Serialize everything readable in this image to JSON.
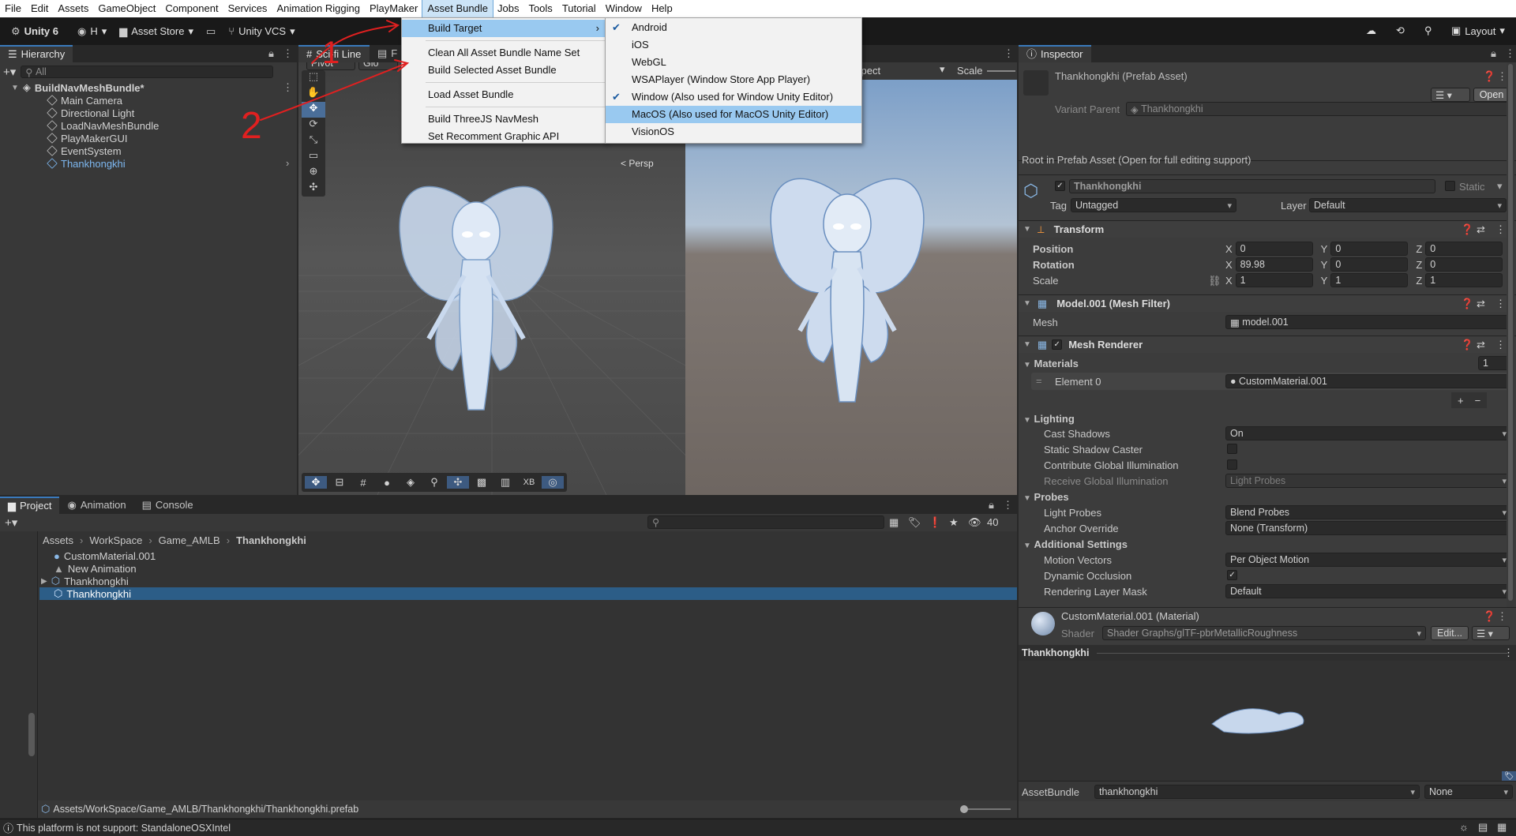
{
  "menubar": {
    "items": [
      "File",
      "Edit",
      "Assets",
      "GameObject",
      "Component",
      "Services",
      "Animation Rigging",
      "PlayMaker",
      "Asset Bundle",
      "Jobs",
      "Tools",
      "Tutorial",
      "Window",
      "Help"
    ]
  },
  "toolbar": {
    "unity": "Unity 6",
    "account": "H",
    "store": "Asset Store",
    "vcs": "Unity VCS",
    "layout": "Layout"
  },
  "asset_bundle_menu": {
    "items": [
      "Build Target",
      "Clean All Asset Bundle Name Set",
      "Build Selected Asset Bundle",
      "Load Asset Bundle",
      "Build ThreeJS NavMesh",
      "Set Recomment Graphic API"
    ]
  },
  "build_target_menu": {
    "items": [
      "Android",
      "iOS",
      "WebGL",
      "WSAPlayer (Window Store App Player)",
      "Window (Also used for Window Unity Editor)",
      "MacOS (Also used for MacOS Unity Editor)",
      "VisionOS"
    ]
  },
  "hierarchy": {
    "tab": "Hierarchy",
    "search_placeholder": "All",
    "scene": "BuildNavMeshBundle*",
    "items": [
      "Main Camera",
      "Directional Light",
      "LoadNavMeshBundle",
      "PlayMakerGUI",
      "EventSystem",
      "Thankhongkhi"
    ]
  },
  "scene_view": {
    "tab1": "Sci-fi Line",
    "tab2": "F",
    "pivot": "Pivot",
    "global": "Glo",
    "persp": "< Persp",
    "aspect_label": "spect",
    "scale_label": "Scale",
    "xb_label": "XB"
  },
  "project": {
    "tabs": [
      "Project",
      "Animation",
      "Console"
    ],
    "breadcrumb": [
      "Assets",
      "WorkSpace",
      "Game_AMLB",
      "Thankhongkhi"
    ],
    "items": [
      "CustomMaterial.001",
      "New Animation",
      "Thankhongkhi",
      "Thankhongkhi"
    ],
    "path": "Assets/WorkSpace/Game_AMLB/Thankhongkhi/Thankhongkhi.prefab",
    "count": "40"
  },
  "inspector": {
    "tab": "Inspector",
    "title": "Thankhongkhi (Prefab Asset)",
    "open_button": "Open",
    "variant_label": "Variant Parent",
    "variant_value": "Thankhongkhi",
    "root_note": "Root in Prefab Asset (Open for full editing support)",
    "name": "Thankhongkhi",
    "static": "Static",
    "tag_label": "Tag",
    "tag_value": "Untagged",
    "layer_label": "Layer",
    "layer_value": "Default",
    "transform": {
      "title": "Transform",
      "position_label": "Position",
      "rotation_label": "Rotation",
      "scale_label": "Scale",
      "position": [
        "0",
        "0",
        "0"
      ],
      "rotation": [
        "89.98",
        "0",
        "0"
      ],
      "scale": [
        "1",
        "1",
        "1"
      ]
    },
    "mesh_filter": {
      "title": "Model.001 (Mesh Filter)",
      "mesh_label": "Mesh",
      "mesh_value": "model.001"
    },
    "mesh_renderer": {
      "title": "Mesh Renderer",
      "materials_label": "Materials",
      "materials_count": "1",
      "element_label": "Element 0",
      "element_value": "CustomMaterial.001",
      "lighting": "Lighting",
      "cast_shadows_label": "Cast Shadows",
      "cast_shadows_value": "On",
      "static_shadow_label": "Static Shadow Caster",
      "contribute_gi_label": "Contribute Global Illumination",
      "receive_gi_label": "Receive Global Illumination",
      "receive_gi_value": "Light Probes",
      "probes": "Probes",
      "light_probes_label": "Light Probes",
      "light_probes_value": "Blend Probes",
      "anchor_label": "Anchor Override",
      "anchor_value": "None (Transform)",
      "additional": "Additional Settings",
      "motion_label": "Motion Vectors",
      "motion_value": "Per Object Motion",
      "occlusion_label": "Dynamic Occlusion",
      "rlm_label": "Rendering Layer Mask",
      "rlm_value": "Default"
    },
    "material": {
      "title": "CustomMaterial.001 (Material)",
      "shader_label": "Shader",
      "shader_value": "Shader Graphs/glTF-pbrMetallicRoughness",
      "edit": "Edit..."
    },
    "preview_title": "Thankhongkhi",
    "assetbundle_label": "AssetBundle",
    "assetbundle_value": "thankhongkhi",
    "assetbundle_variant": "None"
  },
  "status_bar": {
    "message": "This platform is not support: StandaloneOSXIntel"
  },
  "annotations": [
    "1",
    "2"
  ]
}
